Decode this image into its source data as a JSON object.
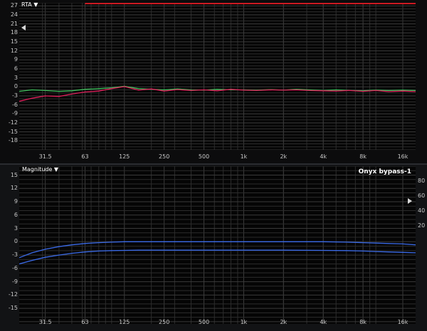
{
  "rta": {
    "menu_label": "RTA ▼",
    "y_ticks": [
      "27",
      "24",
      "21",
      "18",
      "15",
      "12",
      "9",
      "6",
      "3",
      "0",
      "-3",
      "-6",
      "-9",
      "-12",
      "-15",
      "-18"
    ],
    "y_range": [
      -21,
      28
    ],
    "series": [
      {
        "color": "#3fbf5c",
        "x": [
          20,
          25,
          31.5,
          40,
          50,
          63,
          80,
          100,
          125,
          160,
          200,
          250,
          315,
          400,
          500,
          630,
          800,
          1000,
          1250,
          1600,
          2000,
          2500,
          3150,
          4000,
          5000,
          6300,
          8000,
          10000,
          12500,
          16000,
          20000
        ],
        "y": [
          -1.5,
          -1.0,
          -1.2,
          -1.5,
          -1.3,
          -0.8,
          -0.6,
          -0.3,
          0.2,
          -0.6,
          -0.8,
          -1.0,
          -0.7,
          -1.0,
          -1.1,
          -0.8,
          -1.0,
          -1.0,
          -1.1,
          -0.9,
          -1.1,
          -0.8,
          -1.0,
          -1.2,
          -1.0,
          -1.2,
          -1.3,
          -1.1,
          -1.2,
          -1.1,
          -1.2
        ]
      },
      {
        "color": "#e01e5a",
        "x": [
          20,
          25,
          31.5,
          40,
          50,
          63,
          80,
          100,
          125,
          160,
          200,
          250,
          315,
          400,
          500,
          630,
          800,
          1000,
          1250,
          1600,
          2000,
          2500,
          3150,
          4000,
          5000,
          6300,
          8000,
          10000,
          12500,
          16000,
          20000
        ],
        "y": [
          -4.8,
          -3.8,
          -3.0,
          -3.2,
          -2.4,
          -1.7,
          -1.4,
          -0.6,
          0.1,
          -1.1,
          -0.7,
          -1.4,
          -0.9,
          -1.2,
          -1.0,
          -1.3,
          -0.8,
          -1.1,
          -1.2,
          -1.0,
          -1.1,
          -1.0,
          -1.2,
          -1.3,
          -1.4,
          -1.2,
          -1.5,
          -1.2,
          -1.6,
          -1.4,
          -1.6
        ]
      }
    ]
  },
  "magnitude": {
    "menu_label": "Magnitude ▼",
    "preset": "Onyx bypass-1",
    "y_ticks": [
      "15",
      "12",
      "9",
      "6",
      "3",
      "0",
      "-3",
      "-6",
      "-9",
      "-12",
      "-15"
    ],
    "y_range": [
      -18.5,
      17
    ],
    "right_ticks": [
      "80",
      "60",
      "40",
      "20"
    ],
    "series": [
      {
        "color": "#3a6ae8",
        "x": [
          20,
          25,
          31.5,
          40,
          50,
          63,
          80,
          100,
          125,
          160,
          200,
          300,
          500,
          1000,
          1500,
          2000,
          4000,
          6000,
          8000,
          10000,
          12500,
          16000,
          20000
        ],
        "y": [
          -3.6,
          -2.5,
          -1.7,
          -1.1,
          -0.7,
          -0.4,
          -0.2,
          -0.1,
          0,
          0,
          0,
          0,
          0,
          0,
          0,
          0,
          0,
          -0.1,
          -0.2,
          -0.3,
          -0.4,
          -0.5,
          -0.7
        ]
      },
      {
        "color": "#3a6ae8",
        "x": [
          20,
          25,
          31.5,
          40,
          50,
          63,
          80,
          100,
          125,
          160,
          200,
          300,
          500,
          1000,
          2000,
          4000,
          6000,
          8000,
          10000,
          12500,
          16000,
          20000
        ],
        "y": [
          -5.0,
          -4.2,
          -3.5,
          -3.0,
          -2.6,
          -2.3,
          -2.1,
          -2.0,
          -1.95,
          -1.9,
          -1.9,
          -1.9,
          -1.9,
          -1.9,
          -1.9,
          -1.95,
          -2.0,
          -2.1,
          -2.2,
          -2.3,
          -2.4,
          -2.5
        ]
      }
    ]
  },
  "x_ticks": [
    {
      "label": "31.5",
      "hz": 31.5
    },
    {
      "label": "63",
      "hz": 63
    },
    {
      "label": "125",
      "hz": 125
    },
    {
      "label": "250",
      "hz": 250
    },
    {
      "label": "500",
      "hz": 500
    },
    {
      "label": "1k",
      "hz": 1000
    },
    {
      "label": "2k",
      "hz": 2000
    },
    {
      "label": "4k",
      "hz": 4000
    },
    {
      "label": "8k",
      "hz": 8000
    },
    {
      "label": "16k",
      "hz": 16000
    }
  ],
  "x_range_hz": [
    20,
    20000
  ],
  "colors": {
    "grid": "#2c2c2c",
    "grid_major": "#3a3a3a",
    "rta_limit": "#cc1a22"
  }
}
